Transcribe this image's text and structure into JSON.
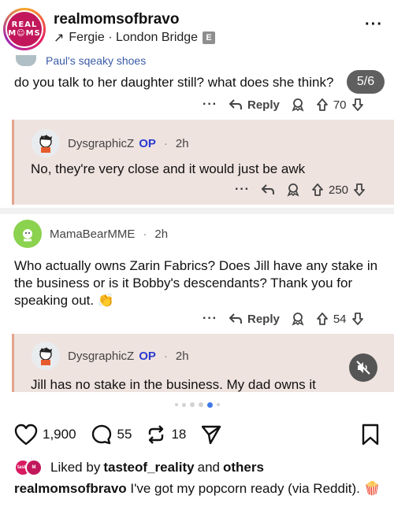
{
  "header": {
    "username": "realmomsofbravo",
    "avatar_line1": "REAL",
    "avatar_line2": "M☺MS",
    "audio_arrow": "↗",
    "audio_label": "Fergie · London Bridge",
    "explicit_badge": "E",
    "more": "···"
  },
  "post": {
    "prev_username": "Paul's sqeaky shoes",
    "comment1": {
      "text": "do you talk to her daughter still? what does she think?",
      "page_indicator": "5/6",
      "reply_label": "Reply",
      "votes": "70"
    },
    "reply1": {
      "user": "DysgraphicZ",
      "op": "OP",
      "time": "2h",
      "text": "No, they're very close and it would just be awk",
      "votes": "250"
    },
    "comment2": {
      "user": "MamaBearMME",
      "time": "2h",
      "text": "Who actually owns Zarin Fabrics?  Does Jill have any stake in the business or is it Bobby's descendants?  Thank you for speaking out. 👏",
      "reply_label": "Reply",
      "votes": "54"
    },
    "reply2": {
      "user": "DysgraphicZ",
      "op": "OP",
      "time": "2h",
      "text": "Jill has no stake in the business. My dad owns it"
    },
    "dot_sep": "·",
    "more": "···"
  },
  "carousel": {
    "count": 6,
    "active_index": 4
  },
  "actions": {
    "likes": "1,900",
    "comments": "55",
    "reposts": "18"
  },
  "liked_by": {
    "prefix": "Liked by",
    "user": "tasteof_reality",
    "and": "and",
    "others": "others"
  },
  "caption": {
    "user": "realmomsofbravo",
    "text": " I've got my popcorn ready (via Reddit). 🍿"
  },
  "colors": {
    "reply_bg": "#efe3df",
    "reply_border": "#e4a48e",
    "op_blue": "#2a3bd1",
    "link_blue": "#3b5ba9",
    "carousel_active": "#3d79e8"
  }
}
